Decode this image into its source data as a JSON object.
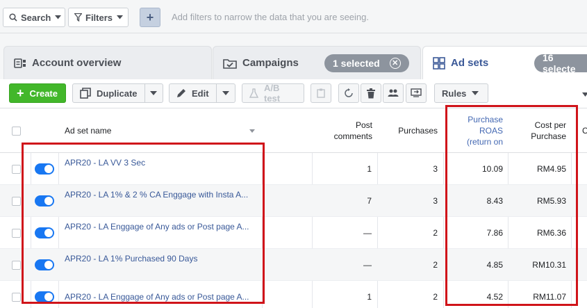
{
  "filterbar": {
    "search_label": "Search",
    "filters_label": "Filters",
    "add_label": "+",
    "hint": "Add filters to narrow the data that you are seeing."
  },
  "tabs": [
    {
      "label": "Account overview",
      "icon": "account-overview-icon"
    },
    {
      "label": "Campaigns",
      "icon": "campaigns-folder-icon",
      "pill": "1 selected"
    },
    {
      "label": "Ad sets",
      "icon": "ad-sets-grid-icon",
      "pill": "16 selecte"
    }
  ],
  "toolbar": {
    "create": "Create",
    "duplicate": "Duplicate",
    "edit": "Edit",
    "ab_test": "A/B test",
    "rules": "Rules"
  },
  "columns": {
    "name": "Ad set name",
    "post_comments": "Post comments",
    "purchases": "Purchases",
    "roas": "Purchase ROAS (return on",
    "cost": "Cost per Purchase"
  },
  "rows": [
    {
      "name": "APR20 - LA VV 3 Sec",
      "post_comments": "1",
      "purchases": "3",
      "roas": "10.09",
      "cost": "RM4.95"
    },
    {
      "name": "APR20 - LA 1% & 2 % CA Enggage with Insta A...",
      "post_comments": "7",
      "purchases": "3",
      "roas": "8.43",
      "cost": "RM5.93"
    },
    {
      "name": "APR20 - LA Enggage of Any ads or Post page A...",
      "post_comments": "—",
      "purchases": "2",
      "roas": "7.86",
      "cost": "RM6.36"
    },
    {
      "name": "APR20 - LA 1% Purchased 90 Days",
      "post_comments": "—",
      "purchases": "2",
      "roas": "4.85",
      "cost": "RM10.31"
    },
    {
      "name": "APR20 - LA Enggage of Any ads or Post page A...",
      "post_comments": "1",
      "purchases": "2",
      "roas": "4.52",
      "cost": "RM11.07"
    }
  ],
  "colors": {
    "create_green": "#42b72a",
    "toggle_blue": "#1877f2",
    "highlight_red": "#d0141a",
    "link_blue": "#385898"
  }
}
